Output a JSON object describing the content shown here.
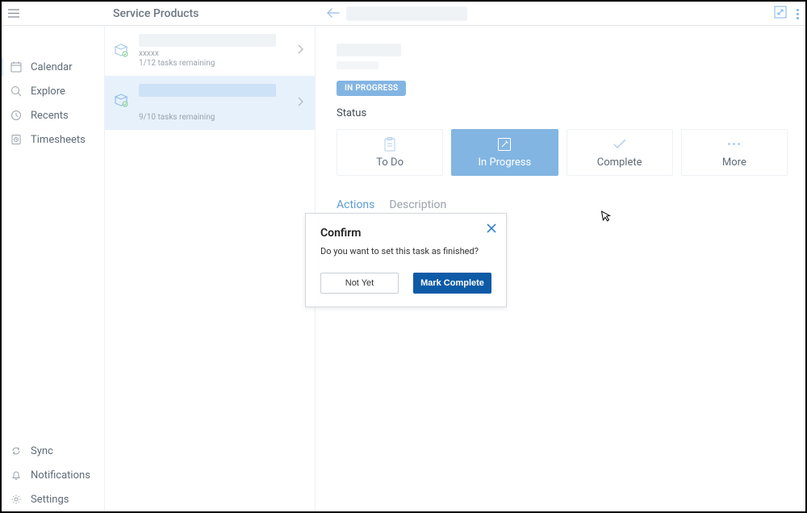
{
  "header": {
    "title": "Service Products"
  },
  "nav": {
    "items": [
      {
        "label": "Calendar",
        "icon": "calendar-icon"
      },
      {
        "label": "Explore",
        "icon": "search-icon"
      },
      {
        "label": "Recents",
        "icon": "clock-icon"
      },
      {
        "label": "Timesheets",
        "icon": "timesheet-icon"
      }
    ],
    "bottom": [
      {
        "label": "Sync",
        "icon": "sync-icon"
      },
      {
        "label": "Notifications",
        "icon": "bell-icon"
      },
      {
        "label": "Settings",
        "icon": "gear-icon"
      }
    ]
  },
  "list": {
    "items": [
      {
        "subtitle1": "xxxxx",
        "subtitle2": "1/12 tasks remaining",
        "selected": false
      },
      {
        "subtitle1": "",
        "subtitle2": "9/10 tasks remaining",
        "selected": true
      }
    ]
  },
  "detail": {
    "badge": "IN PROGRESS",
    "status_label": "Status",
    "status_cards": [
      {
        "label": "To Do",
        "icon": "clipboard-icon",
        "selected": false
      },
      {
        "label": "In Progress",
        "icon": "edit-icon",
        "selected": true
      },
      {
        "label": "Complete",
        "icon": "check-icon",
        "selected": false
      },
      {
        "label": "More",
        "icon": "more-icon",
        "selected": false
      }
    ],
    "tabs": [
      {
        "label": "Actions",
        "active": true
      },
      {
        "label": "Description",
        "active": false
      }
    ]
  },
  "dialog": {
    "title": "Confirm",
    "message": "Do you want to set this task as finished?",
    "secondary": "Not Yet",
    "primary": "Mark Complete"
  }
}
